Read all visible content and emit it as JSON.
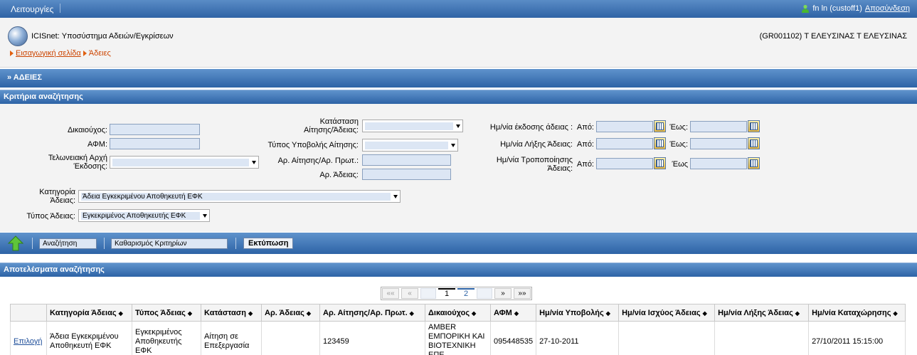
{
  "topbar": {
    "menu": "Λειτουργίες",
    "user": "fn ln (custoff1)",
    "logout": "Αποσύνδεση"
  },
  "header": {
    "app_title": "ICISnet: Υποσύστημα Αδειών/Εγκρίσεων",
    "office": "(GR001102) Τ ΕΛΕΥΣΙΝΑΣ Τ ΕΛΕΥΣΙΝΑΣ",
    "breadcrumb": {
      "home": "Εισαγωγική σελίδα",
      "current": "Άδειες"
    }
  },
  "section_title": "» ΑΔΕΙΕΣ",
  "criteria": {
    "title": "Κριτήρια αναζήτησης",
    "beneficiary": "Δικαιούχος:",
    "afm": "ΑΦΜ:",
    "customs_office_1": "Τελωνειακή Αρχή",
    "customs_office_2": "Έκδοσης:",
    "status_1": "Κατάσταση",
    "status_2": "Αίτησης/Άδειας:",
    "submission_type": "Τύπος Υποβολής Αίτησης:",
    "application_no": "Αρ. Αίτησης/Αρ. Πρωτ.:",
    "license_no": "Αρ. Άδειας:",
    "issue_date": "Ημ/νία έκδοσης άδειας :",
    "expiry_date": "Ημ/νία Λήξης Άδειας:",
    "modify_date_1": "Ημ/νία Τροποποίησης",
    "modify_date_2": "Άδειας:",
    "from": "Από:",
    "to": "Έως:",
    "to_nocolon": "Έως",
    "category_1": "Κατηγορία",
    "category_2": "Άδειας:",
    "category_value": "Άδεια Εγκεκριμένου Αποθηκευτή ΕΦΚ",
    "license_type": "Τύπος Άδειας:",
    "license_type_value": "Εγκεκριμένος Αποθηκευτής ΕΦΚ"
  },
  "toolbar": {
    "search": "Αναζήτηση",
    "clear": "Καθαρισμός Κριτηρίων",
    "print": "Εκτύπωση"
  },
  "results": {
    "title": "Αποτελέσματα αναζήτησης",
    "pager": {
      "first": "««",
      "prev": "«",
      "page1": "1",
      "page2": "2",
      "next": "»",
      "last": "»»"
    },
    "columns": [
      "",
      "Κατηγορία Άδειας",
      "Τύπος Άδειας",
      "Κατάσταση",
      "Αρ. Άδειας",
      "Αρ. Αίτησης/Αρ. Πρωτ.",
      "Δικαιούχος",
      "ΑΦΜ",
      "Ημ/νία Υποβολής",
      "Ημ/νία Ισχύος Άδειας",
      "Ημ/νία Λήξης Άδειας",
      "Ημ/νία Καταχώρησης"
    ],
    "rows": [
      {
        "select": "Επιλογή",
        "category": "Άδεια Εγκεκριμένου Αποθηκευτή ΕΦΚ",
        "type": "Εγκεκριμένος Αποθηκευτής ΕΦΚ",
        "status": "Αίτηση σε Επεξεργασία",
        "license_no": "",
        "application_no": "123459",
        "beneficiary": "AMBER ΕΜΠΟΡΙΚΗ ΚΑΙ ΒΙΟΤΕΧΝΙΚΗ ΕΠΕ",
        "afm": "095448535",
        "submission_date": "27-10-2011",
        "valid_date": "",
        "expiry_date": "",
        "registration_date": "27/10/2011 15:15:00"
      }
    ]
  }
}
